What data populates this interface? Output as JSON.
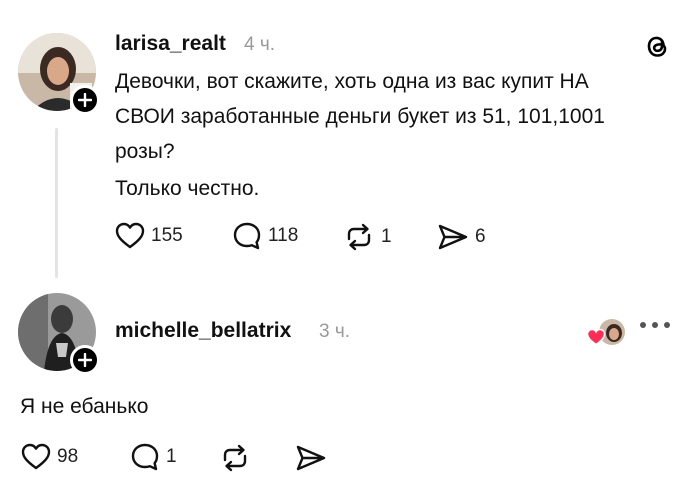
{
  "post": {
    "username": "larisa_realt",
    "time": "4 ч.",
    "text_line1": "Девочки, вот скажите, хоть одна из вас купит НА",
    "text_line2": "СВОИ заработанные деньги букет из 51, 101,1001",
    "text_line3": "розы?",
    "text_line4": "Только честно.",
    "likes": "155",
    "comments": "118",
    "reposts": "1",
    "shares": "6"
  },
  "reply": {
    "username": "michelle_bellatrix",
    "time": "3 ч.",
    "text": "Я не ебанько",
    "likes": "98",
    "comments": "1"
  },
  "icons": {
    "like": "heart-icon",
    "comment": "comment-bubble-icon",
    "repost": "repost-icon",
    "share": "send-icon",
    "logo": "threads-logo-icon",
    "follow": "plus-icon",
    "more": "more-dots-icon"
  },
  "colors": {
    "text": "#111111",
    "muted": "#999999",
    "heart_badge": "#ff2d55"
  }
}
